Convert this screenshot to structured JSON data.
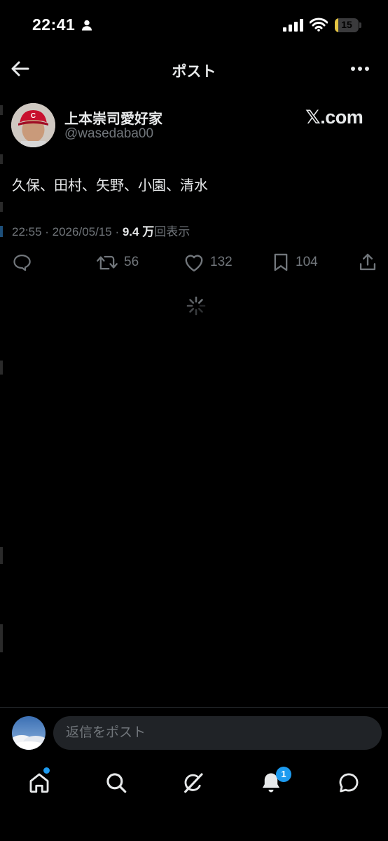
{
  "status_bar": {
    "time": "22:41",
    "battery": "15",
    "battery_level": 0.15
  },
  "header": {
    "title": "ポスト"
  },
  "author": {
    "display_name": "上本崇司愛好家",
    "handle": "@wasedaba00",
    "badge": "𝕏.com"
  },
  "post": {
    "text": "久保、田村、矢野、小園、清水",
    "timestamp": "22:55 · 2026/05/15 · ",
    "views_count": "9.4 万",
    "views_label": "回表示"
  },
  "actions": {
    "retweets": "56",
    "likes": "132",
    "bookmarks": "104"
  },
  "reply_bar": {
    "placeholder": "返信をポスト"
  },
  "tab_bar": {
    "notification_count": "1"
  },
  "colors": {
    "accent": "#1d9bf0",
    "background": "#000000",
    "text_primary": "#e7e9ea",
    "text_secondary": "#71767b"
  },
  "icons": [
    "person-icon",
    "signal-icon",
    "wifi-icon",
    "battery-icon",
    "back-arrow-icon",
    "more-dots-icon",
    "reply-icon",
    "retweet-icon",
    "heart-icon",
    "bookmark-icon",
    "share-icon",
    "loading-spinner-icon",
    "home-icon",
    "search-icon",
    "grok-icon",
    "bell-icon",
    "messages-icon"
  ]
}
